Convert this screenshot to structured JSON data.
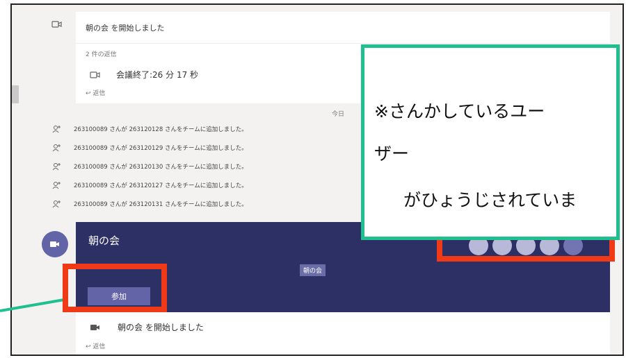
{
  "feed": {
    "started_top": "朝の会 を開始しました",
    "replies_count": "2 件の返信",
    "meeting_ended": "会議終了:26 分 17 秒",
    "reply_top": "↩ 返信",
    "date_divider": "今日",
    "system_messages": [
      "263100089 さんが 263120128 さんをチームに追加しました。",
      "263100089 さんが 263120129 さんをチームに追加しました。",
      "263100089 さんが 263120130 さんをチームに追加しました。",
      "263100089 さんが 263120127 さんをチームに追加しました。",
      "263100089 さんが 263120131 さんをチームに追加しました。"
    ]
  },
  "meeting": {
    "title": "朝の会",
    "chip": "朝の会",
    "join_label": "参加",
    "participant_count": 5
  },
  "feed_bottom": {
    "started": "朝の会 を開始しました",
    "reply": "↩ 返信"
  },
  "callout": {
    "line1": "※さんかしているユー",
    "line2": "ザー",
    "line3": "がひょうじされていま"
  },
  "colors": {
    "meeting_bg": "#2d3064",
    "accent": "#6264a7",
    "highlight_red": "#f03a17",
    "callout_border": "#1fbf8f"
  },
  "icons": [
    "video-camera-icon",
    "add-person-icon",
    "reply-arrow-icon"
  ]
}
